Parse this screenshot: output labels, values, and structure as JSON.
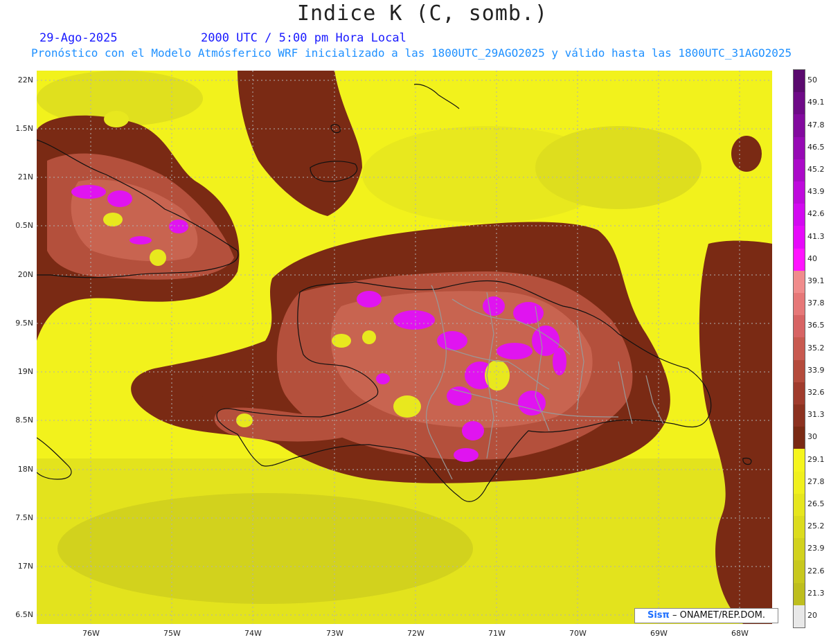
{
  "title": "Indice K (C, somb.)",
  "date": "29-Ago-2025",
  "valid_time": "2000 UTC / 5:00 pm Hora Local",
  "description": "Pronóstico con el Modelo Atmósferico WRF inicializado a las 1800UTC_29AGO2025 y válido hasta las  1800UTC_31AGO2025",
  "lat_labels": [
    "22N",
    "1.5N",
    "21N",
    "0.5N",
    "20N",
    "9.5N",
    "19N",
    "8.5N",
    "18N",
    "7.5N",
    "17N",
    "6.5N"
  ],
  "lon_labels": [
    "76W",
    "75W",
    "74W",
    "73W",
    "72W",
    "71W",
    "70W",
    "69W",
    "68W"
  ],
  "colorbar": {
    "labels": [
      "50",
      "49.1",
      "47.8",
      "46.5",
      "45.2",
      "43.9",
      "42.6",
      "41.3",
      "40",
      "39.1",
      "37.8",
      "36.5",
      "35.2",
      "33.9",
      "32.6",
      "31.3",
      "30",
      "29.1",
      "27.8",
      "26.5",
      "25.2",
      "23.9",
      "22.6",
      "21.3",
      "20"
    ],
    "colors": [
      "#5a0a6e",
      "#6e0a87",
      "#820a9e",
      "#960ab4",
      "#aa0ac8",
      "#be0adc",
      "#d20af0",
      "#e60afa",
      "#ff14ff",
      "#f08c8c",
      "#e67878",
      "#d76464",
      "#c85a50",
      "#b44b3c",
      "#a03c2d",
      "#8c3220",
      "#7a2a14",
      "#f5f51e",
      "#f0f01e",
      "#e6e61e",
      "#dcdc1e",
      "#d2d21e",
      "#c8c81e",
      "#bebe1e",
      "#e8e8e8"
    ]
  },
  "credit": {
    "brand": "Sisπ",
    "text": "– ONAMET/REP.DOM."
  },
  "colors": {
    "low": "#e8e81e",
    "high": "#7a2a14",
    "mid": "#c06050",
    "very_high": "#e014f0",
    "coast": "#111111",
    "border": "#999999"
  }
}
